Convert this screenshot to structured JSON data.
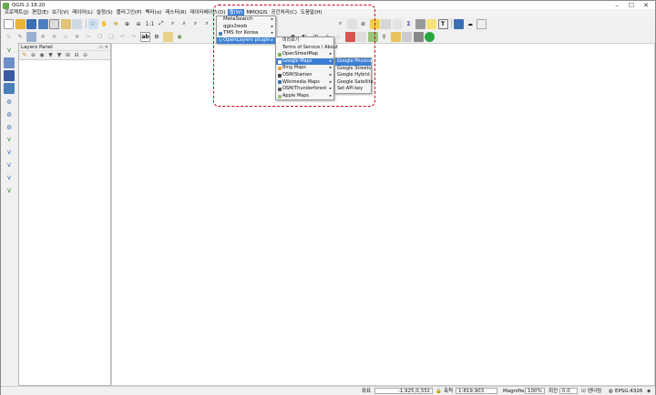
{
  "window": {
    "title": "QGIS 2.18.20"
  },
  "menubar": [
    "프로젝트(J)",
    "편집(E)",
    "보기(V)",
    "레이어(L)",
    "설정(S)",
    "플러그인(P)",
    "벡터(o)",
    "래스터(R)",
    "데이터베이스(D)",
    "웹(W)",
    "MMQGIS",
    "공간처리(C)",
    "도움말(H)"
  ],
  "web_menu": [
    "MetaSearch",
    "qgis2web",
    "TMS for Korea",
    "OpenLayers plugin"
  ],
  "openlayers_menu": [
    "미리보기",
    "Terms of Service / About",
    "OpenStreetMap",
    "Google Maps",
    "Bing Maps",
    "OSM/Stamen",
    "Wikimedia Maps",
    "OSM/Thunderforest",
    "Apple Maps"
  ],
  "google_menu": [
    "Google Physical",
    "Google Streets",
    "Google Hybrid",
    "Google Satellite",
    "Set API key"
  ],
  "layers_panel": {
    "title": "Layers Panel"
  },
  "status": {
    "coord_label": "좌표",
    "coord_value": "-1,925,0,332",
    "scale_label": "축척",
    "scale_value": "1:819,903",
    "magnifier_label": "Magnifier",
    "magnifier_value": "100%",
    "rotation_label": "회전",
    "rotation_value": "0.0",
    "render_label": "렌더링",
    "crs": "EPSG:4326"
  },
  "colors": {
    "highlight": "#3c7fd4",
    "annotation": "#d0021b"
  }
}
